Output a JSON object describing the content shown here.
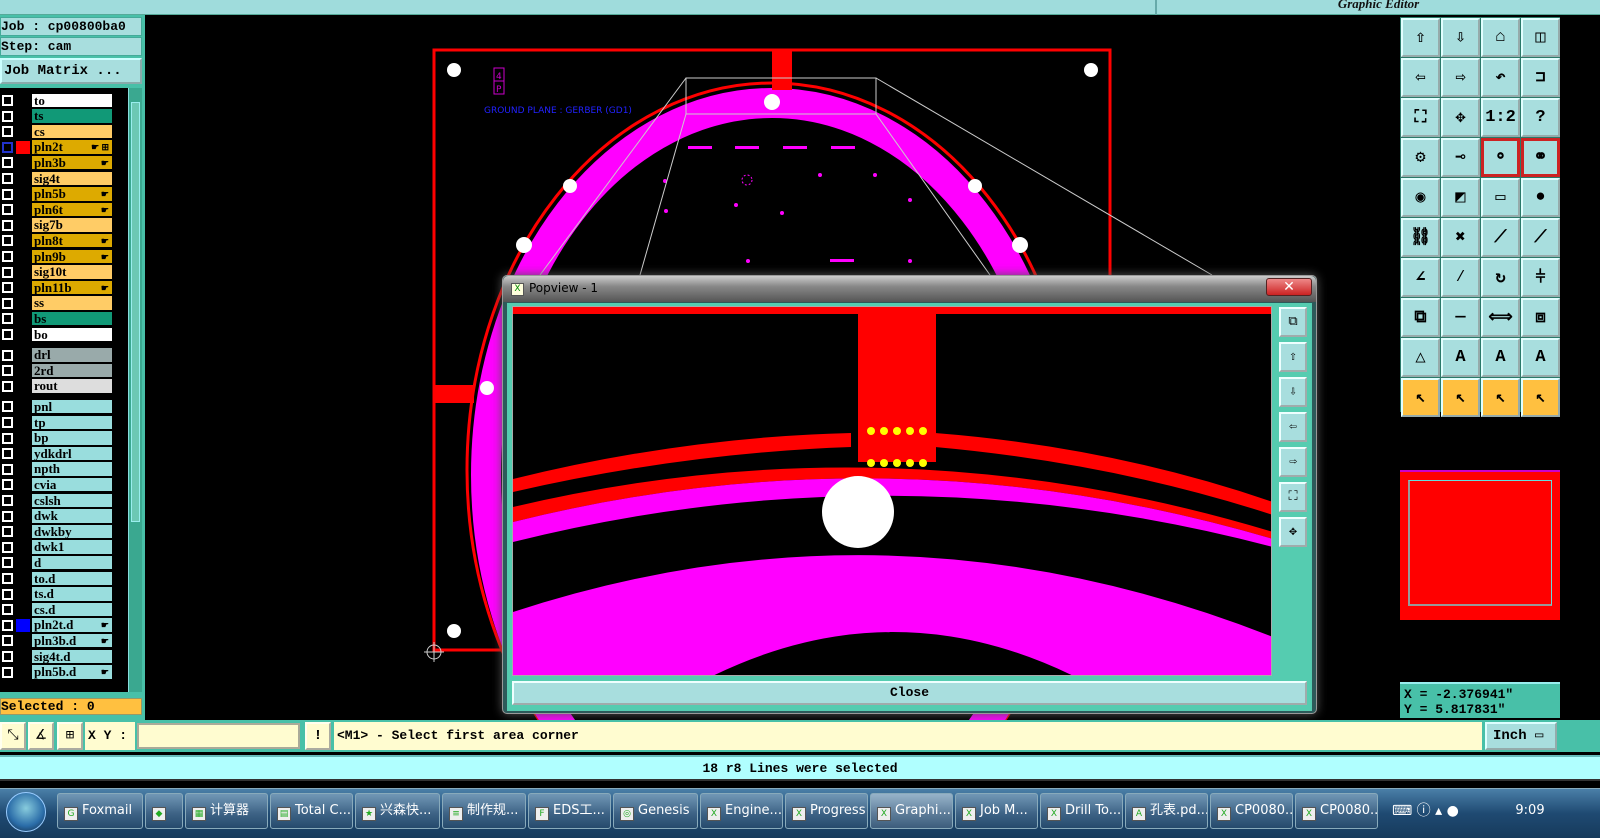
{
  "window": {
    "title": "Graphic Editor"
  },
  "job": {
    "job_label": "Job : cp00800ba0",
    "step_label": "Step: cam",
    "matrix_button": "Job Matrix ..."
  },
  "layers": [
    {
      "name": "to",
      "color": "#ffffff",
      "group": 1
    },
    {
      "name": "ts",
      "color": "#119977",
      "group": 1
    },
    {
      "name": "cs",
      "color": "#ffcc66",
      "group": 1
    },
    {
      "name": "pln2t",
      "color": "#ddaa00",
      "group": 1,
      "hand": true,
      "active": true,
      "swatch": "#ff0000",
      "extra": "⊞"
    },
    {
      "name": "pln3b",
      "color": "#ddaa00",
      "group": 1,
      "hand": true
    },
    {
      "name": "sig4t",
      "color": "#ffcc66",
      "group": 1
    },
    {
      "name": "pln5b",
      "color": "#ddaa00",
      "group": 1,
      "hand": true
    },
    {
      "name": "pln6t",
      "color": "#ddaa00",
      "group": 1,
      "hand": true
    },
    {
      "name": "sig7b",
      "color": "#ffcc66",
      "group": 1
    },
    {
      "name": "pln8t",
      "color": "#ddaa00",
      "group": 1,
      "hand": true
    },
    {
      "name": "pln9b",
      "color": "#ddaa00",
      "group": 1,
      "hand": true
    },
    {
      "name": "sig10t",
      "color": "#ffcc66",
      "group": 1
    },
    {
      "name": "pln11b",
      "color": "#ddaa00",
      "group": 1,
      "hand": true
    },
    {
      "name": "ss",
      "color": "#ffcc66",
      "group": 1
    },
    {
      "name": "bs",
      "color": "#119977",
      "group": 1
    },
    {
      "name": "bo",
      "color": "#ffffff",
      "group": 1
    },
    {
      "name": "drl",
      "color": "#99aaaa",
      "group": 2
    },
    {
      "name": "2rd",
      "color": "#99aaaa",
      "group": 2
    },
    {
      "name": "rout",
      "color": "#dddddd",
      "group": 2
    },
    {
      "name": "pnl",
      "color": "#99dddd",
      "group": 3
    },
    {
      "name": "tp",
      "color": "#99dddd",
      "group": 3
    },
    {
      "name": "bp",
      "color": "#99dddd",
      "group": 3
    },
    {
      "name": "ydkdrl",
      "color": "#99dddd",
      "group": 3
    },
    {
      "name": "npth",
      "color": "#99dddd",
      "group": 3
    },
    {
      "name": "cvia",
      "color": "#99dddd",
      "group": 3
    },
    {
      "name": "cslsh",
      "color": "#99dddd",
      "group": 3
    },
    {
      "name": "dwk",
      "color": "#99dddd",
      "group": 3
    },
    {
      "name": "dwkby",
      "color": "#99dddd",
      "group": 3
    },
    {
      "name": "dwk1",
      "color": "#99dddd",
      "group": 3
    },
    {
      "name": "d",
      "color": "#99dddd",
      "group": 3
    },
    {
      "name": "to.d",
      "color": "#99dddd",
      "group": 3
    },
    {
      "name": "ts.d",
      "color": "#99dddd",
      "group": 3
    },
    {
      "name": "cs.d",
      "color": "#99dddd",
      "group": 3
    },
    {
      "name": "pln2t.d",
      "color": "#99dddd",
      "group": 3,
      "hand": true,
      "swatch": "#0000ff"
    },
    {
      "name": "pln3b.d",
      "color": "#99dddd",
      "group": 3,
      "hand": true
    },
    {
      "name": "sig4t.d",
      "color": "#99dddd",
      "group": 3
    },
    {
      "name": "pln5b.d",
      "color": "#99dddd",
      "group": 3,
      "hand": true
    }
  ],
  "selected_label": "Selected : 0",
  "command": {
    "xy_label": "X Y :",
    "xy_value": "",
    "message": "<M1> - Select first area corner",
    "units": "Inch"
  },
  "status": "18 r8 Lines were selected",
  "canvas": {
    "annotation": "GROUND PLANE : GERBER (GD1)",
    "layer_tag_top": "4",
    "layer_tag_bottom": "P"
  },
  "coords": {
    "x": "X = -2.376941\"",
    "y": "Y = 5.817831\""
  },
  "tools": [
    {
      "icon": "move-up-icon",
      "g": "⇧"
    },
    {
      "icon": "move-down-icon",
      "g": "⇩"
    },
    {
      "icon": "home-icon",
      "g": "⌂"
    },
    {
      "icon": "panel-right-icon",
      "g": "◫"
    },
    {
      "icon": "move-left-icon",
      "g": "⇦"
    },
    {
      "icon": "move-right-icon",
      "g": "⇨"
    },
    {
      "icon": "undo-view-icon",
      "g": "↶"
    },
    {
      "icon": "redraw-icon",
      "g": "⊐"
    },
    {
      "icon": "zoom-fit-icon",
      "g": "⛶"
    },
    {
      "icon": "zoom-center-icon",
      "g": "✥"
    },
    {
      "icon": "zoom-ratio-icon",
      "g": "1:2"
    },
    {
      "icon": "help-icon",
      "g": "?"
    },
    {
      "icon": "settings-icon",
      "g": "⚙"
    },
    {
      "icon": "snap-icon",
      "g": "⊸"
    },
    {
      "icon": "net-icon",
      "g": "⚬",
      "red": true
    },
    {
      "icon": "net-pins-icon",
      "g": "⚭",
      "red": true
    },
    {
      "icon": "pad-icon",
      "g": "◉"
    },
    {
      "icon": "polygon-icon",
      "g": "◩"
    },
    {
      "icon": "measure-icon",
      "g": "▭"
    },
    {
      "icon": "circle-icon",
      "g": "●"
    },
    {
      "icon": "connect-icon",
      "g": "⛓"
    },
    {
      "icon": "delete-icon",
      "g": "✖"
    },
    {
      "icon": "line-icon",
      "g": "⟋"
    },
    {
      "icon": "line-end-icon",
      "g": "⟋"
    },
    {
      "icon": "angle-icon",
      "g": "∠"
    },
    {
      "icon": "slash-icon",
      "g": "⁄"
    },
    {
      "icon": "arc-icon",
      "g": "↻"
    },
    {
      "icon": "mirror-icon",
      "g": "⫩"
    },
    {
      "icon": "copy-icon",
      "g": "⧉"
    },
    {
      "icon": "line-h-icon",
      "g": "—"
    },
    {
      "icon": "spacing-icon",
      "g": "⟺"
    },
    {
      "icon": "shapes-icon",
      "g": "⧈"
    },
    {
      "icon": "triangle-icon",
      "g": "△"
    },
    {
      "icon": "triangle-a-icon",
      "g": "A"
    },
    {
      "icon": "arch-icon",
      "g": "A"
    },
    {
      "icon": "arch-line-icon",
      "g": "A"
    },
    {
      "icon": "pointer-icon",
      "g": "↖",
      "org": true
    },
    {
      "icon": "pointer-box-icon",
      "g": "↖",
      "org": true
    },
    {
      "icon": "pointer-circle-icon",
      "g": "↖",
      "org": true
    },
    {
      "icon": "pointer-route-icon",
      "g": "↖",
      "org": true
    }
  ],
  "popview": {
    "title": "Popview - 1",
    "close_label": "Close",
    "side_buttons": [
      "zoom-window-icon",
      "pan-up-icon",
      "pan-down-icon",
      "pan-left-icon",
      "pan-right-icon",
      "fit-icon",
      "center-icon"
    ]
  },
  "taskbar": {
    "items": [
      {
        "label": "Foxmail",
        "icon": "foxmail-icon"
      },
      {
        "label": "",
        "icon": "app-icon"
      },
      {
        "label": "计算器",
        "icon": "calculator-icon"
      },
      {
        "label": "Total C...",
        "icon": "floppy-icon"
      },
      {
        "label": "兴森快...",
        "icon": "star-icon"
      },
      {
        "label": "制作规...",
        "icon": "doc-icon"
      },
      {
        "label": "EDS工...",
        "icon": "eds-icon"
      },
      {
        "label": "Genesis",
        "icon": "genesis-icon"
      },
      {
        "label": "Engine...",
        "icon": "x-window-icon"
      },
      {
        "label": "Progress",
        "icon": "x-window-icon"
      },
      {
        "label": "Graphi...",
        "icon": "x-window-icon",
        "active": true
      },
      {
        "label": "Job M...",
        "icon": "x-window-icon"
      },
      {
        "label": "Drill To...",
        "icon": "x-window-icon"
      },
      {
        "label": "孔表.pd...",
        "icon": "pdf-icon"
      },
      {
        "label": "CP0080...",
        "icon": "excel-icon"
      },
      {
        "label": "CP0080...",
        "icon": "excel-icon"
      }
    ],
    "clock": "9:09"
  },
  "colors": {
    "board": "#ff0000",
    "copper": "#ff00ff",
    "pads": "#ffff00",
    "panel": "#48c0a8"
  }
}
